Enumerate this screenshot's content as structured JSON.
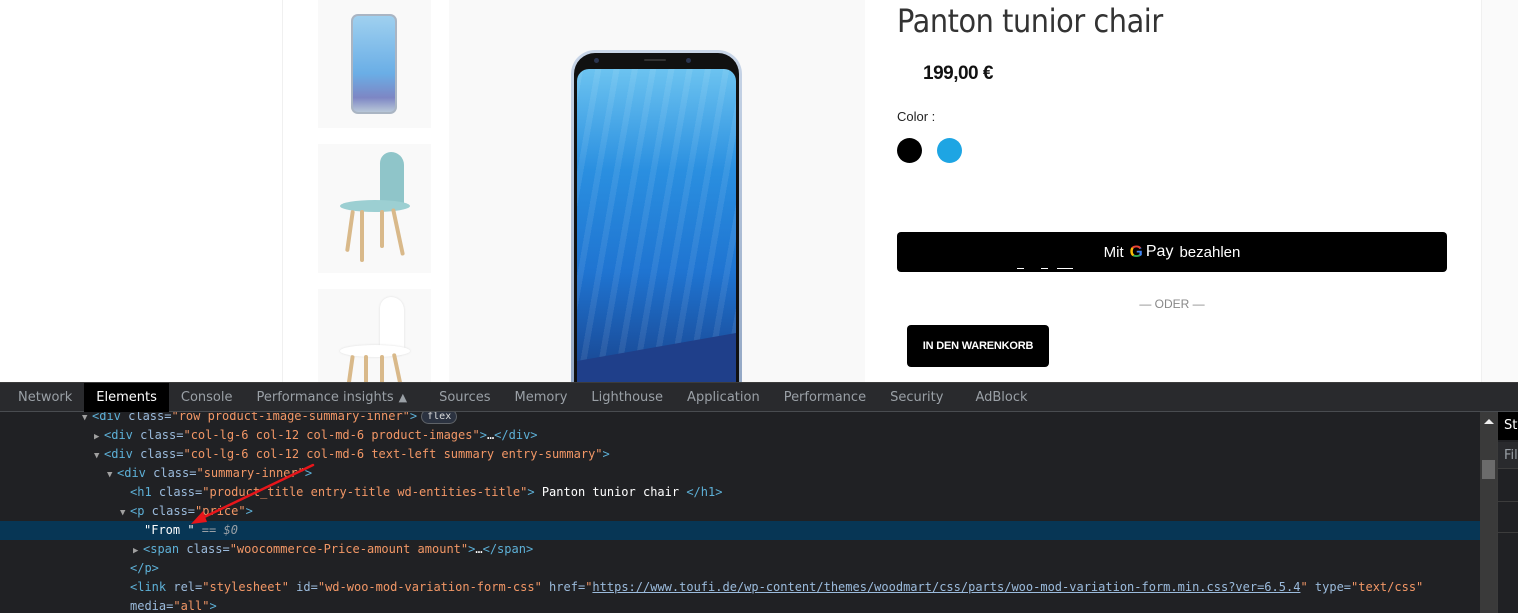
{
  "product": {
    "title": "Panton tunior chair",
    "price": "199,00 €",
    "color_label": "Color :",
    "swatches": [
      {
        "name": "black",
        "color": "#000000"
      },
      {
        "name": "blue",
        "color": "#1ea5e3"
      }
    ],
    "gpay": {
      "prefix": "Mit",
      "g": "G",
      "pay": "Pay",
      "suffix": "bezahlen"
    },
    "separator": "— ODER —",
    "add_to_cart": "IN DEN WARENKORB",
    "thumbnails": [
      "phone-blue",
      "chair-teal",
      "chair-white"
    ]
  },
  "devtools": {
    "tabs": [
      {
        "label": "Network",
        "active": false
      },
      {
        "label": "Elements",
        "active": true
      },
      {
        "label": "Console",
        "active": false
      },
      {
        "label": "Performance insights",
        "active": false,
        "icon": "flask-icon"
      },
      {
        "label": "Sources",
        "active": false
      },
      {
        "label": "Memory",
        "active": false
      },
      {
        "label": "Lighthouse",
        "active": false
      },
      {
        "label": "Application",
        "active": false
      },
      {
        "label": "Performance",
        "active": false
      },
      {
        "label": "Security",
        "active": false
      },
      {
        "label": "AdBlock",
        "active": false
      }
    ],
    "side_panel": {
      "tab": "Styles",
      "filter": "Filter"
    },
    "flex_badge": "flex",
    "tree": {
      "l1": {
        "open": "<div",
        "attr": " class=",
        "val": "\"row product-image-summary-inner\"",
        "close": ">"
      },
      "l2": {
        "open": "<div",
        "attr": " class=",
        "val": "\"col-lg-6 col-12 col-md-6 product-images\"",
        "close": ">",
        "ellipsis": "…",
        "end": "</div>"
      },
      "l3": {
        "open": "<div",
        "attr": " class=",
        "val": "\"col-lg-6 col-12 col-md-6 text-left summary entry-summary\"",
        "close": ">"
      },
      "l4": {
        "open": "<div",
        "attr": " class=",
        "val": "\"summary-inner\"",
        "close": ">"
      },
      "l5": {
        "open": "<h1",
        "attr": " class=",
        "val": "\"product_title entry-title wd-entities-title\"",
        "close": ">",
        "text": " Panton tunior chair ",
        "end": "</h1>"
      },
      "l6": {
        "open": "<p",
        "attr": " class=",
        "val": "\"price\"",
        "close": ">"
      },
      "l7": {
        "text": "\"From \"",
        "marker": " == $0"
      },
      "l8": {
        "open": "<span",
        "attr": " class=",
        "val": "\"woocommerce-Price-amount amount\"",
        "close": ">",
        "ellipsis": "…",
        "end": "</span>"
      },
      "l9": {
        "end": "</p>"
      },
      "l10": {
        "open": "<link",
        "a1": " rel=",
        "v1": "\"stylesheet\"",
        "a2": " id=",
        "v2": "\"wd-woo-mod-variation-form-css\"",
        "a3": " href=",
        "q": "\"",
        "href": "https://www.toufi.de/wp-content/themes/woodmart/css/parts/woo-mod-variation-form.min.css?ver=6.5.4",
        "a4": " type=",
        "v4": "\"text/css\""
      },
      "l11": {
        "a1": "media=",
        "v1": "\"all\"",
        "close": ">"
      }
    }
  }
}
